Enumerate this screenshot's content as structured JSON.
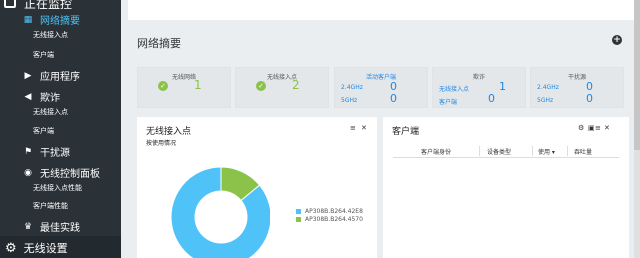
{
  "sidebar": {
    "top_label": "正在监控",
    "items": [
      {
        "label": "网络摘要",
        "icon": "grid-icon",
        "active": true
      },
      {
        "sub": "无线接入点"
      },
      {
        "sub": "客户端"
      },
      {
        "label": "应用程序",
        "icon": "play-circle-icon"
      },
      {
        "label": "欺诈",
        "icon": "megaphone-icon"
      },
      {
        "sub": "无线接入点"
      },
      {
        "sub": "客户端"
      },
      {
        "label": "干扰源",
        "icon": "flag-icon"
      },
      {
        "label": "无线控制面板",
        "icon": "dashboard-icon"
      },
      {
        "sub": "无线接入点性能"
      },
      {
        "sub": "客户端性能"
      },
      {
        "label": "最佳实践",
        "icon": "trophy-icon"
      }
    ],
    "bottom_label": "无线设置"
  },
  "main": {
    "title": "网络摘要",
    "stats": [
      {
        "label": "无线网络",
        "value": "1"
      },
      {
        "label": "无线接入点",
        "value": "2"
      },
      {
        "label": "活动客户端",
        "rows": [
          {
            "k": "2.4GHz",
            "v": "0"
          },
          {
            "k": "5GHz",
            "v": "0"
          }
        ]
      },
      {
        "label": "欺诈",
        "rows": [
          {
            "k": "无线接入点",
            "v": "1"
          },
          {
            "k": "客户端",
            "v": "0"
          }
        ]
      },
      {
        "label": "干扰源",
        "rows": [
          {
            "k": "2.4GHz",
            "v": "0"
          },
          {
            "k": "5GHz",
            "v": "0"
          }
        ]
      }
    ],
    "ap_panel": {
      "title": "无线接入点",
      "subtitle": "按使用情况",
      "legend": [
        "AP308B.B264.42E8",
        "AP308B.B264.4570"
      ]
    },
    "client_panel": {
      "title": "客户端",
      "columns": [
        "客户端身份",
        "设备类型",
        "使用 ▾",
        "吞吐量"
      ]
    }
  },
  "colors": {
    "accent": "#4fc3f7",
    "green": "#8bc34a",
    "blue": "#1e88e5",
    "sidebar": "#2a3137"
  },
  "chart_data": {
    "type": "pie",
    "categories": [
      "AP308B.B264.42E8",
      "AP308B.B264.4570"
    ],
    "values": [
      86,
      14
    ],
    "title": "无线接入点",
    "subtitle": "按使用情况",
    "legend": "right"
  }
}
